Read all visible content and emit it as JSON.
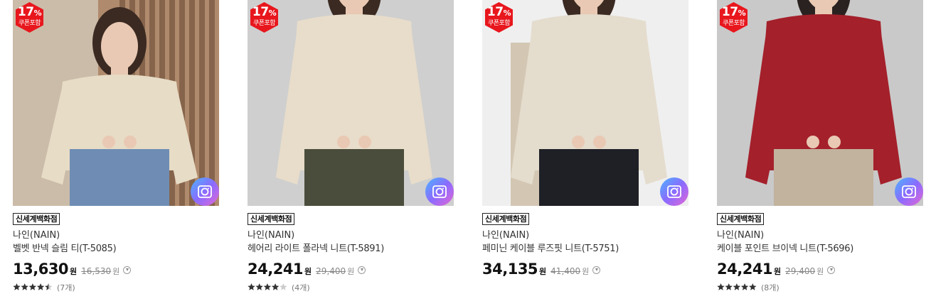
{
  "products": [
    {
      "discount_pct": "17",
      "pct_symbol": "%",
      "coupon_label": "쿠폰포함",
      "store": "신세계백화점",
      "brand": "나인(NAIN)",
      "name": "벨벳 반넥 슬림 티(T-5085)",
      "price": "13,630",
      "currency": "원",
      "original_price": "16,530",
      "rating": 4.5,
      "review_count": "(7개)",
      "photo": {
        "bg": "#7a5a44",
        "bg2": "#b08a6c",
        "top": "#e7dcc6",
        "bottom": "#6f8db4",
        "skin": "#e9c9b3",
        "hair": "#3a2a22"
      }
    },
    {
      "discount_pct": "17",
      "pct_symbol": "%",
      "coupon_label": "쿠폰포함",
      "store": "신세계백화점",
      "brand": "나인(NAIN)",
      "name": "헤어리 라이트 폴라넥 니트(T-5891)",
      "price": "24,241",
      "currency": "원",
      "original_price": "29,400",
      "rating": 4,
      "review_count": "(4개)",
      "photo": {
        "bg": "#dcdcdc",
        "bg2": "#cfcfcf",
        "top": "#e8ddca",
        "bottom": "#4a4d3c",
        "skin": "#e9c9b3",
        "hair": "#3a2a22"
      }
    },
    {
      "discount_pct": "17",
      "pct_symbol": "%",
      "coupon_label": "쿠폰포함",
      "store": "신세계백화점",
      "brand": "나인(NAIN)",
      "name": "페미닌 케이블 루즈핏 니트(T-5751)",
      "price": "34,135",
      "currency": "원",
      "original_price": "41,400",
      "rating": null,
      "review_count": "",
      "photo": {
        "bg": "#d9d6d1",
        "bg2": "#efefef",
        "top": "#e4dccd",
        "bottom": "#1e2026",
        "skin": "#e9c9b3",
        "hair": "#3a2a22"
      }
    },
    {
      "discount_pct": "17",
      "pct_symbol": "%",
      "coupon_label": "쿠폰포함",
      "store": "신세계백화점",
      "brand": "나인(NAIN)",
      "name": "케이블 포인트 브이넥 니트(T-5696)",
      "price": "24,241",
      "currency": "원",
      "original_price": "29,400",
      "rating": 5,
      "review_count": "(8개)",
      "photo": {
        "bg": "#d8d8d8",
        "bg2": "#c9c9c9",
        "top": "#a4202b",
        "bottom": "#c2b39e",
        "skin": "#e9c9b3",
        "hair": "#2a2220"
      }
    }
  ],
  "icons": {
    "badge": "hexagon-badge-icon",
    "lens": "camera-lens-icon",
    "info": "info-chevron-icon",
    "star": "star-icon"
  },
  "colors": {
    "badge_red": "#e8171d",
    "star": "#333333",
    "star_empty": "#cccccc"
  }
}
